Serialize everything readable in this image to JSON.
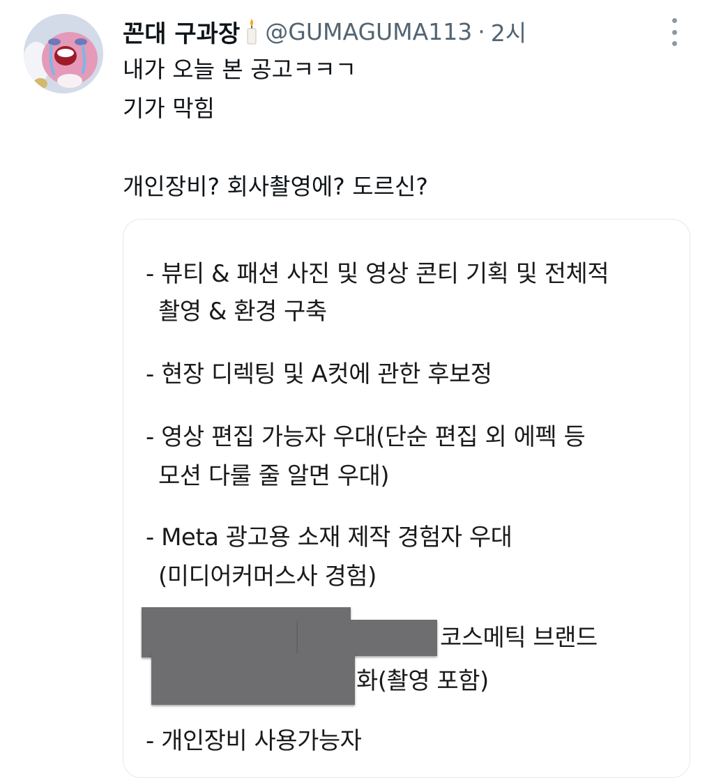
{
  "tweet": {
    "author_name": "꼰대 구과장",
    "name_emoji_icon": "candle-icon",
    "handle": "@GUMAGUMA113",
    "separator": "·",
    "time": "2시",
    "text_lines": [
      "내가 오늘 본 공고ㅋㅋㄱ",
      "기가 막힘",
      "",
      "개인장비? 회사촬영에? 도르신?"
    ]
  },
  "media": {
    "lines": [
      "- 뷰티 & 패션 사진 및 영상 콘티 기획 및 전체적",
      "촬영 & 환경 구축",
      "- 현장 디렉팅 및 A컷에 관한 후보정",
      "- 영상 편집 가능자 우대(단순 편집 외 에펙 등",
      "모션 다룰 줄 알면 우대)",
      "- Meta 광고용 소재 제작 경험자 우대",
      "(미디어커머스사 경험)",
      "코스메틱 브랜드",
      "화(촬영 포함)",
      "- 개인장비 사용가능자"
    ]
  },
  "colors": {
    "text": "#0f1419",
    "secondary": "#536471",
    "border": "#e4e8ec",
    "redaction": "#6e6e70"
  }
}
